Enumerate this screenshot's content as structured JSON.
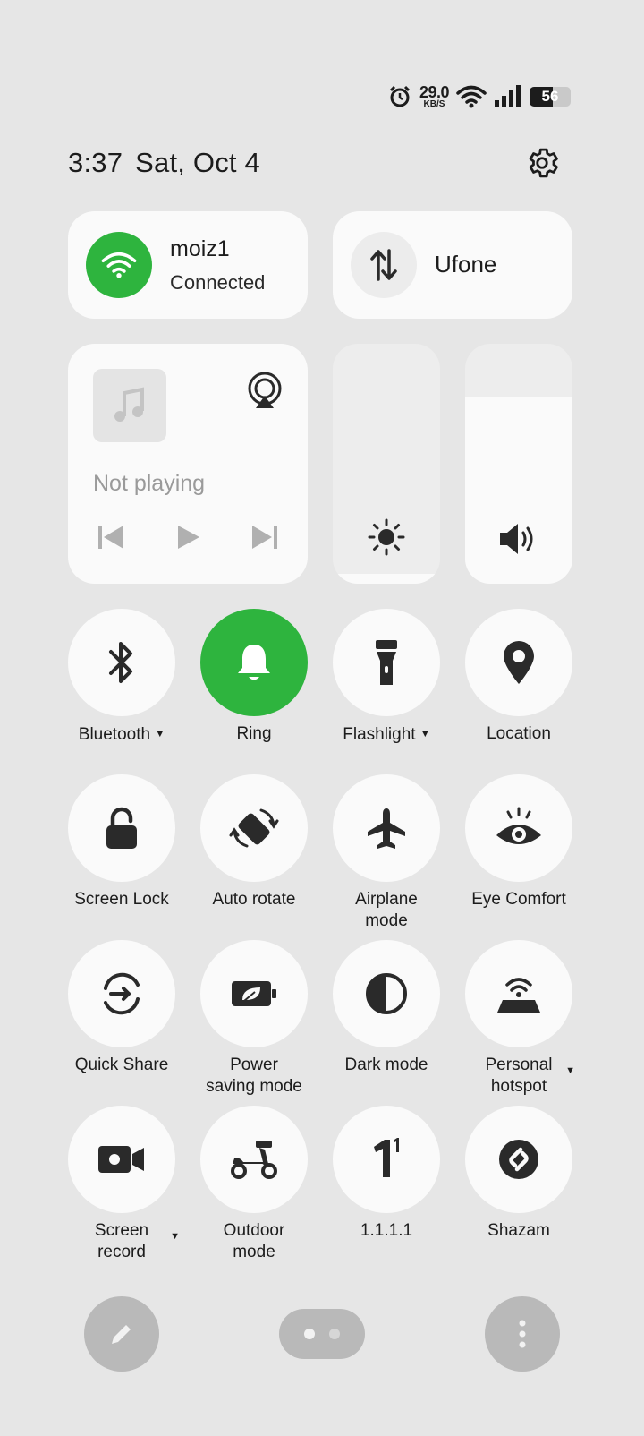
{
  "status_bar": {
    "speed_value": "29.0",
    "speed_unit": "KB/S",
    "battery_level": "56",
    "battery_fraction": 0.56,
    "icons": [
      "alarm-icon",
      "wifi-signal-icon",
      "cellular-signal-icon",
      "battery-icon"
    ]
  },
  "header": {
    "time": "3:37",
    "date": "Sat, Oct 4"
  },
  "wifi": {
    "name": "moiz1",
    "status": "Connected",
    "active_color": "#2eb43e"
  },
  "mobile_data": {
    "carrier": "Ufone"
  },
  "media": {
    "status": "Not playing"
  },
  "brightness": {
    "level": 0.04
  },
  "volume": {
    "level": 0.78
  },
  "tiles": [
    {
      "label": "Bluetooth",
      "icon": "bluetooth-icon",
      "active": false,
      "dropdown": true
    },
    {
      "label": "Ring",
      "icon": "bell-icon",
      "active": true,
      "dropdown": false
    },
    {
      "label": "Flashlight",
      "icon": "flashlight-icon",
      "active": false,
      "dropdown": true
    },
    {
      "label": "Location",
      "icon": "location-icon",
      "active": false,
      "dropdown": false
    },
    {
      "label": "Screen Lock",
      "icon": "lock-icon",
      "active": false,
      "dropdown": false
    },
    {
      "label": "Auto rotate",
      "icon": "auto-rotate-icon",
      "active": false,
      "dropdown": false
    },
    {
      "label_1": "Airplane",
      "label_2": "mode",
      "icon": "airplane-icon",
      "active": false,
      "dropdown": false
    },
    {
      "label": "Eye Comfort",
      "icon": "eye-icon",
      "active": false,
      "dropdown": false
    },
    {
      "label": "Quick Share",
      "icon": "quick-share-icon",
      "active": false,
      "dropdown": false
    },
    {
      "label_1": "Power",
      "label_2": "saving mode",
      "icon": "battery-leaf-icon",
      "active": false,
      "dropdown": false
    },
    {
      "label": "Dark mode",
      "icon": "dark-mode-icon",
      "active": false,
      "dropdown": false
    },
    {
      "label_1": "Personal",
      "label_2": "hotspot",
      "icon": "hotspot-icon",
      "active": false,
      "dropdown": true
    },
    {
      "label_1": "Screen",
      "label_2": "record",
      "icon": "screen-record-icon",
      "active": false,
      "dropdown": true
    },
    {
      "label_1": "Outdoor",
      "label_2": "mode",
      "icon": "scooter-icon",
      "active": false,
      "dropdown": false
    },
    {
      "label": "1.1.1.1",
      "icon": "one-one-icon",
      "active": false,
      "dropdown": false
    },
    {
      "label": "Shazam",
      "icon": "shazam-icon",
      "active": false,
      "dropdown": false
    }
  ],
  "bottom_bar": {
    "page_count": 2,
    "current_page": 1
  }
}
